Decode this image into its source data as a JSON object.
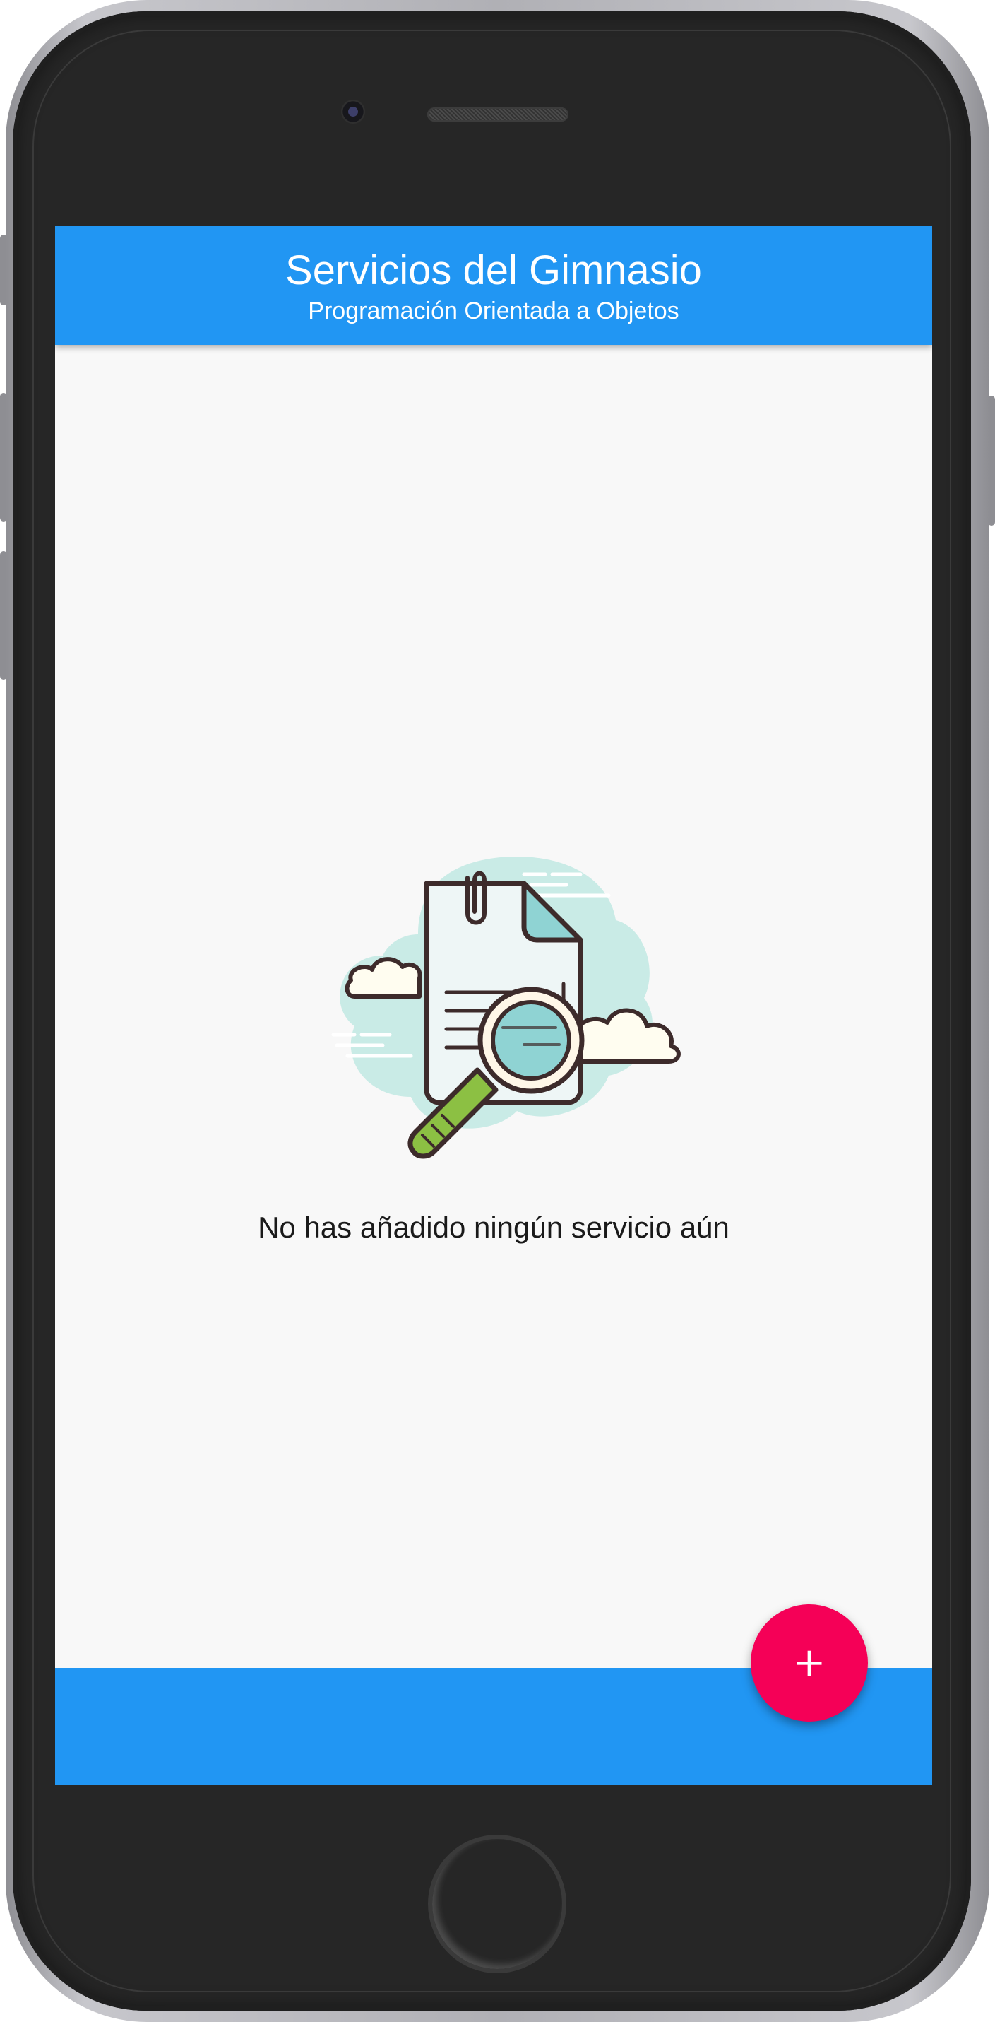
{
  "app_bar": {
    "title": "Servicios del Gimnasio",
    "subtitle": "Programación Orientada a Objetos"
  },
  "empty_state": {
    "message": "No has añadido ningún servicio aún",
    "illustration_icon": "document-search-icon"
  },
  "fab": {
    "label": "+",
    "icon": "add-icon"
  },
  "colors": {
    "primary": "#2196f3",
    "accent": "#f50057",
    "background": "#f8f8f8",
    "device_frame": "#262626"
  }
}
